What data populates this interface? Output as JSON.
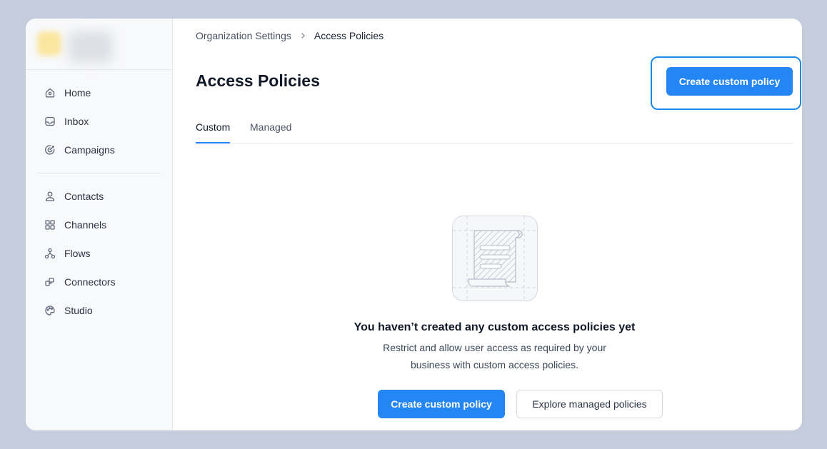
{
  "sidebar": {
    "group1": [
      {
        "label": "Home",
        "icon": "home-icon"
      },
      {
        "label": "Inbox",
        "icon": "inbox-icon"
      },
      {
        "label": "Campaigns",
        "icon": "target-icon"
      }
    ],
    "group2": [
      {
        "label": "Contacts",
        "icon": "user-icon"
      },
      {
        "label": "Channels",
        "icon": "grid-icon"
      },
      {
        "label": "Flows",
        "icon": "flow-icon"
      },
      {
        "label": "Connectors",
        "icon": "connector-icon"
      },
      {
        "label": "Studio",
        "icon": "palette-icon"
      }
    ]
  },
  "breadcrumb": {
    "parent": "Organization Settings",
    "current": "Access Policies"
  },
  "page": {
    "title": "Access Policies",
    "create_button": "Create custom policy"
  },
  "tabs": [
    {
      "label": "Custom",
      "active": true
    },
    {
      "label": "Managed",
      "active": false
    }
  ],
  "empty_state": {
    "title": "You haven’t created any custom access policies yet",
    "description_line1": "Restrict and allow user access as required by your",
    "description_line2": "business with custom access policies.",
    "primary_button": "Create custom policy",
    "secondary_button": "Explore managed policies"
  },
  "colors": {
    "accent": "#2486f5",
    "highlight": "#1e88e5",
    "background": "#c5ccdc"
  }
}
